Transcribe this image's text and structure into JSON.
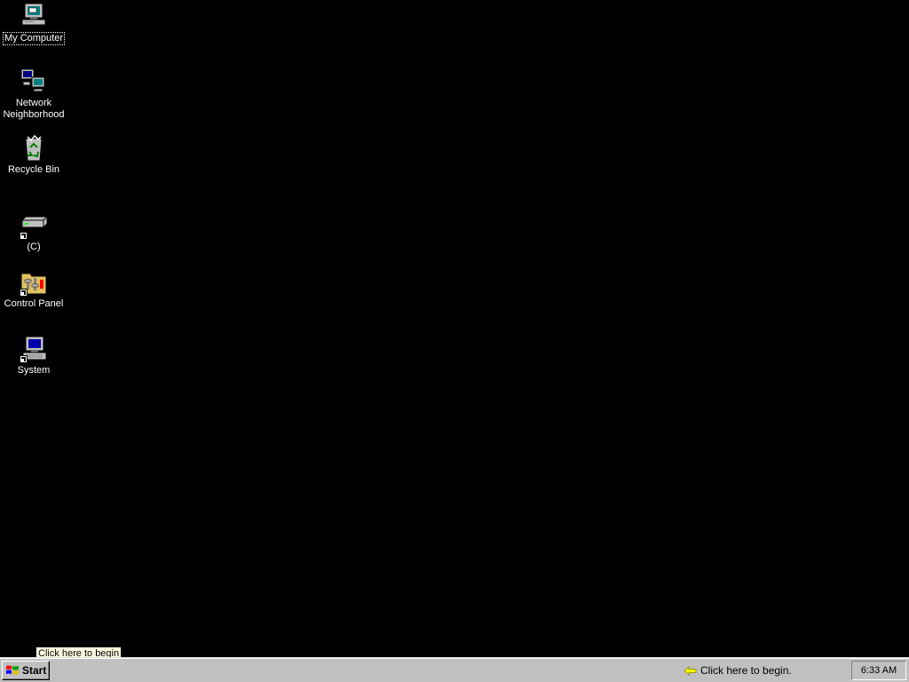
{
  "desktop": {
    "background_color": "#000000",
    "icons": [
      {
        "label": "My Computer",
        "icon": "my-computer-icon",
        "selected": true
      },
      {
        "label": "Network Neighborhood",
        "icon": "network-neighborhood-icon",
        "selected": false
      },
      {
        "label": "Recycle Bin",
        "icon": "recycle-bin-icon",
        "selected": false
      },
      {
        "label": "(C)",
        "icon": "drive-shortcut-icon",
        "selected": false
      },
      {
        "label": "Control Panel",
        "icon": "control-panel-shortcut-icon",
        "selected": false
      },
      {
        "label": "System",
        "icon": "system-shortcut-icon",
        "selected": false
      }
    ]
  },
  "tooltip": {
    "text": "Click here to begin"
  },
  "taskbar": {
    "start_label": "Start",
    "begin_hint": "Click here to begin.",
    "clock": "6:33 AM"
  }
}
